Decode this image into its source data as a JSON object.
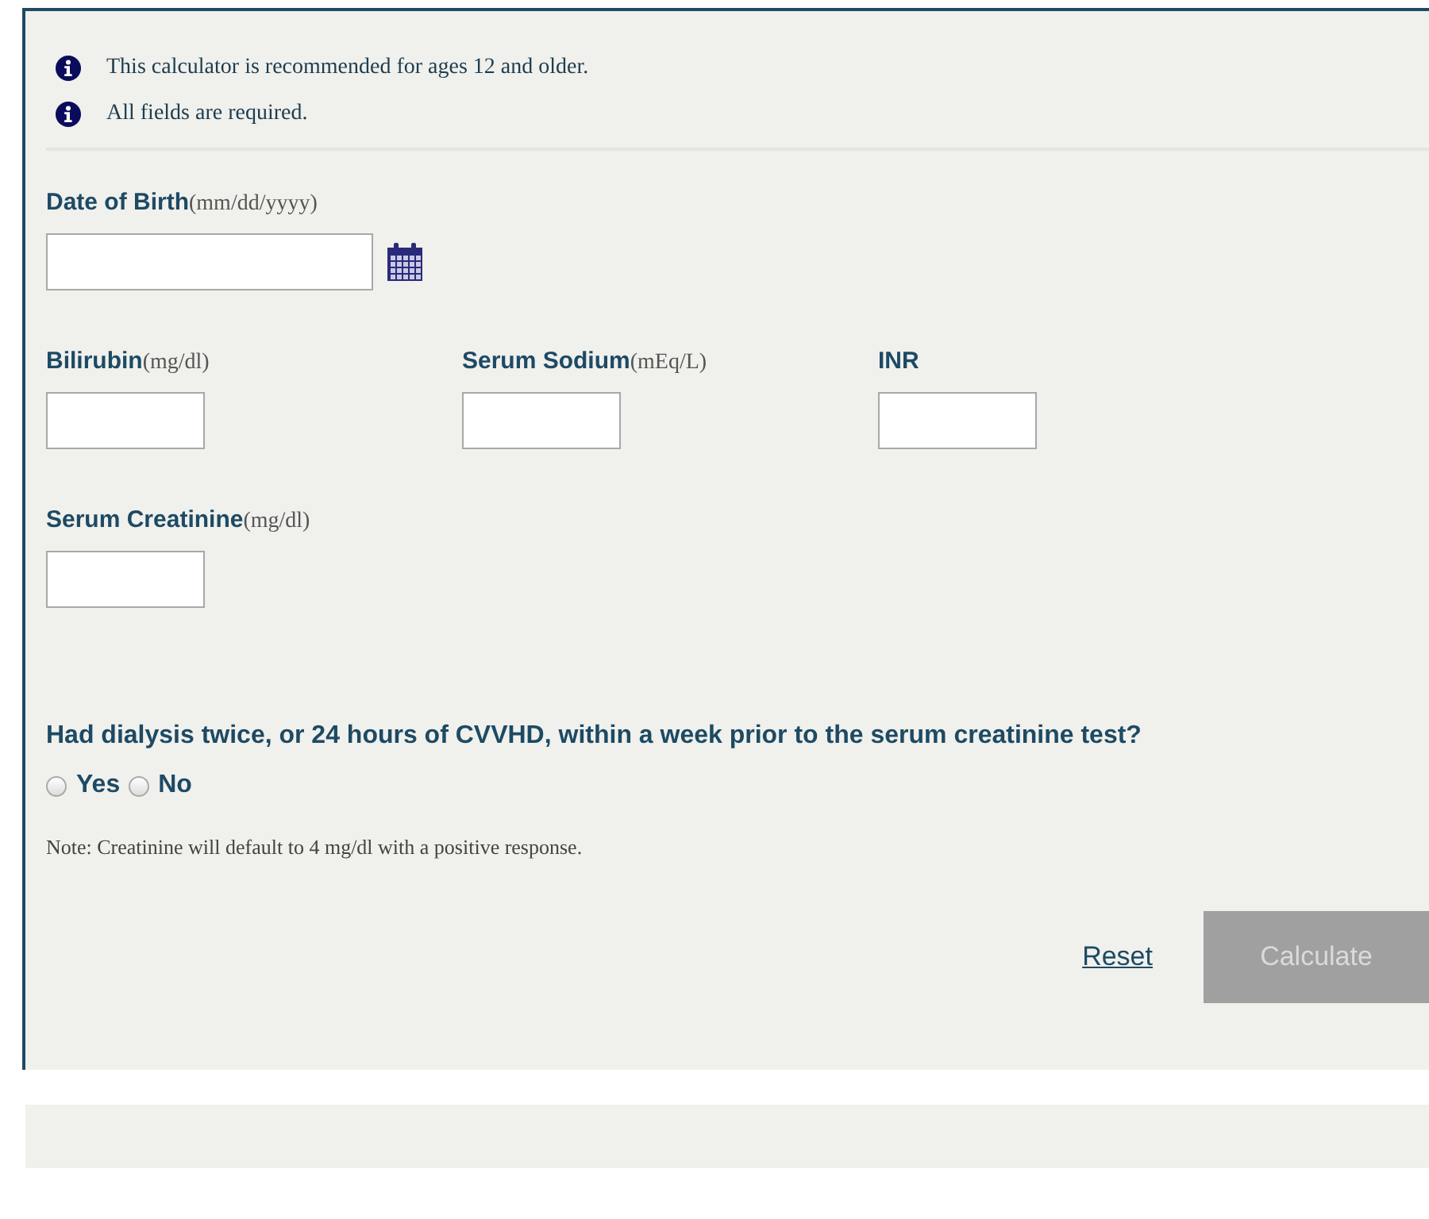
{
  "notices": [
    "This calculator is recommended for ages 12 and older.",
    "All fields are required."
  ],
  "field_rows": [
    [
      {
        "label": "Date of Birth",
        "unit": "(mm/dd/yyyy)",
        "kind": "date"
      }
    ],
    [
      {
        "label": "Bilirubin",
        "unit": "(mg/dl)",
        "kind": "number"
      },
      {
        "label": "Serum Sodium",
        "unit": "(mEq/L)",
        "kind": "number"
      },
      {
        "label": "INR",
        "kind": "number"
      }
    ],
    [
      {
        "label": "Serum Creatinine",
        "unit": "(mg/dl)",
        "kind": "number"
      }
    ]
  ],
  "question": "Had dialysis twice, or 24 hours of CVVHD, within a week prior to the serum creatinine test?",
  "options": [
    {
      "label": "Yes",
      "selected": false
    },
    {
      "label": "No",
      "selected": false
    }
  ],
  "note": "Note: Creatinine will default to 4 mg/dl with a positive response.",
  "reset_link": "Reset",
  "calculate_button": {
    "label": "Calculate",
    "disabled": true
  }
}
